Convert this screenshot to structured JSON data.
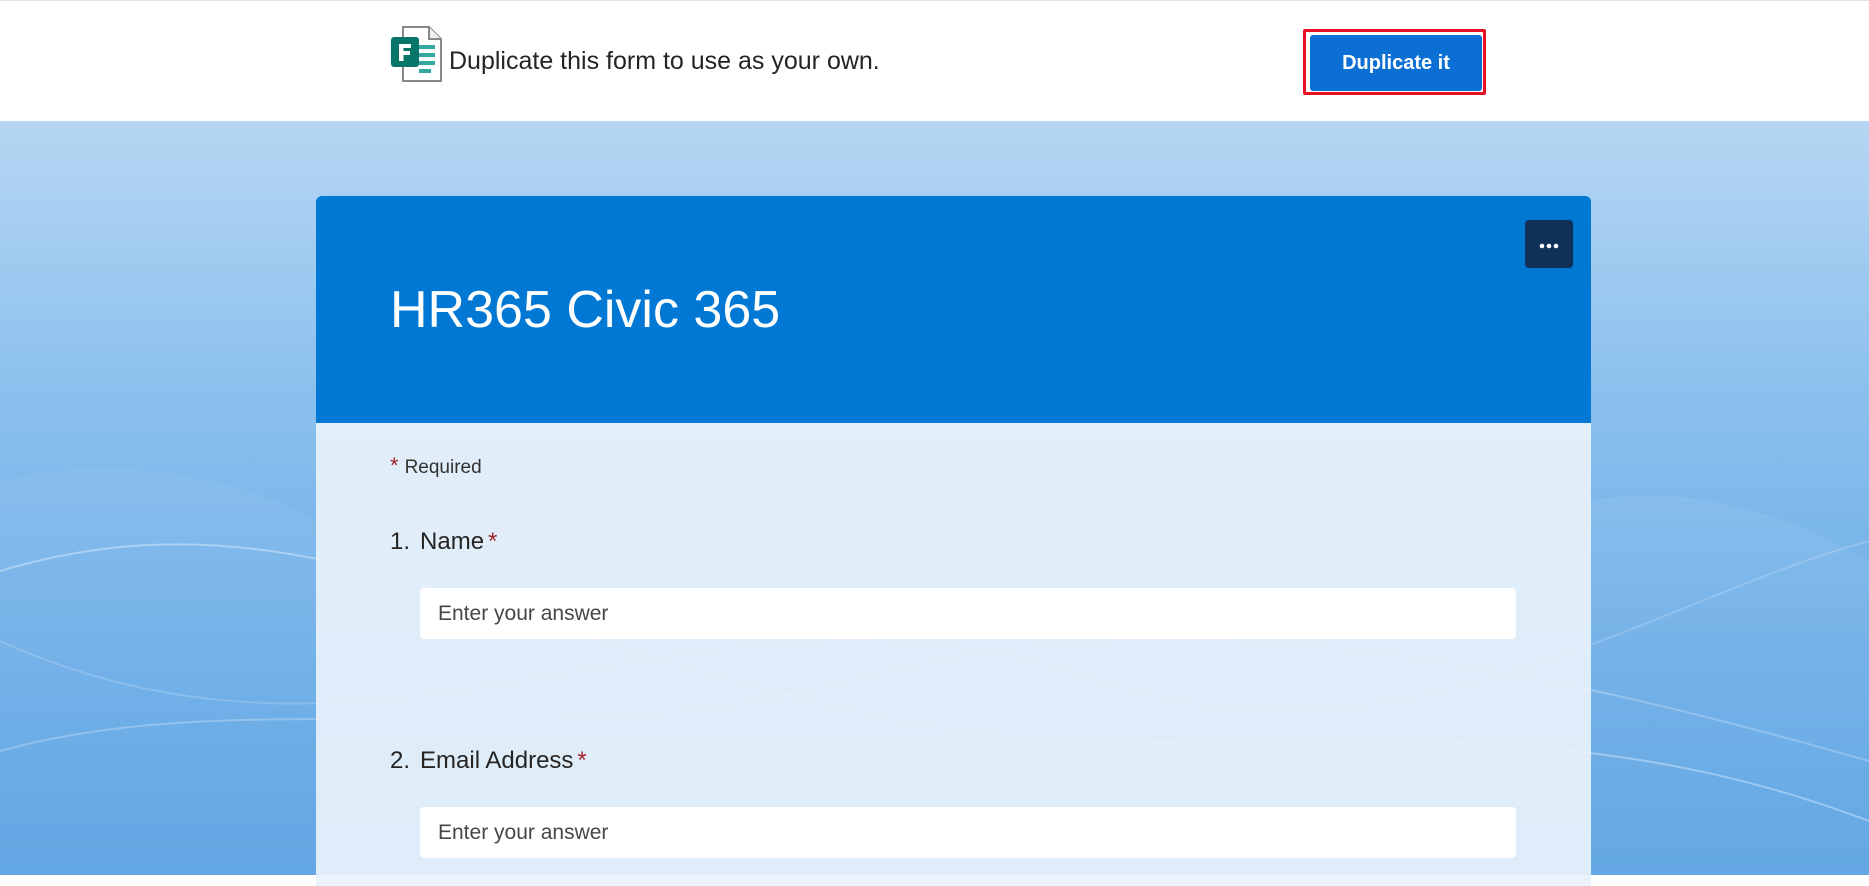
{
  "banner": {
    "icon": "microsoft-forms-icon",
    "message": "Duplicate this form to use as your own.",
    "duplicate_label": "Duplicate it",
    "duplicate_color": "#0b6fd3",
    "highlight_color": "#e81123"
  },
  "form": {
    "title": "HR365 Civic 365",
    "header_color": "#0078d4",
    "more_options_icon": "more-horizontal-icon",
    "required_mark": "*",
    "required_note": "Required",
    "questions": [
      {
        "number": "1.",
        "label": "Name",
        "required_mark": "*",
        "placeholder": "Enter your answer"
      },
      {
        "number": "2.",
        "label": "Email Address",
        "required_mark": "*",
        "placeholder": "Enter your answer"
      }
    ]
  }
}
